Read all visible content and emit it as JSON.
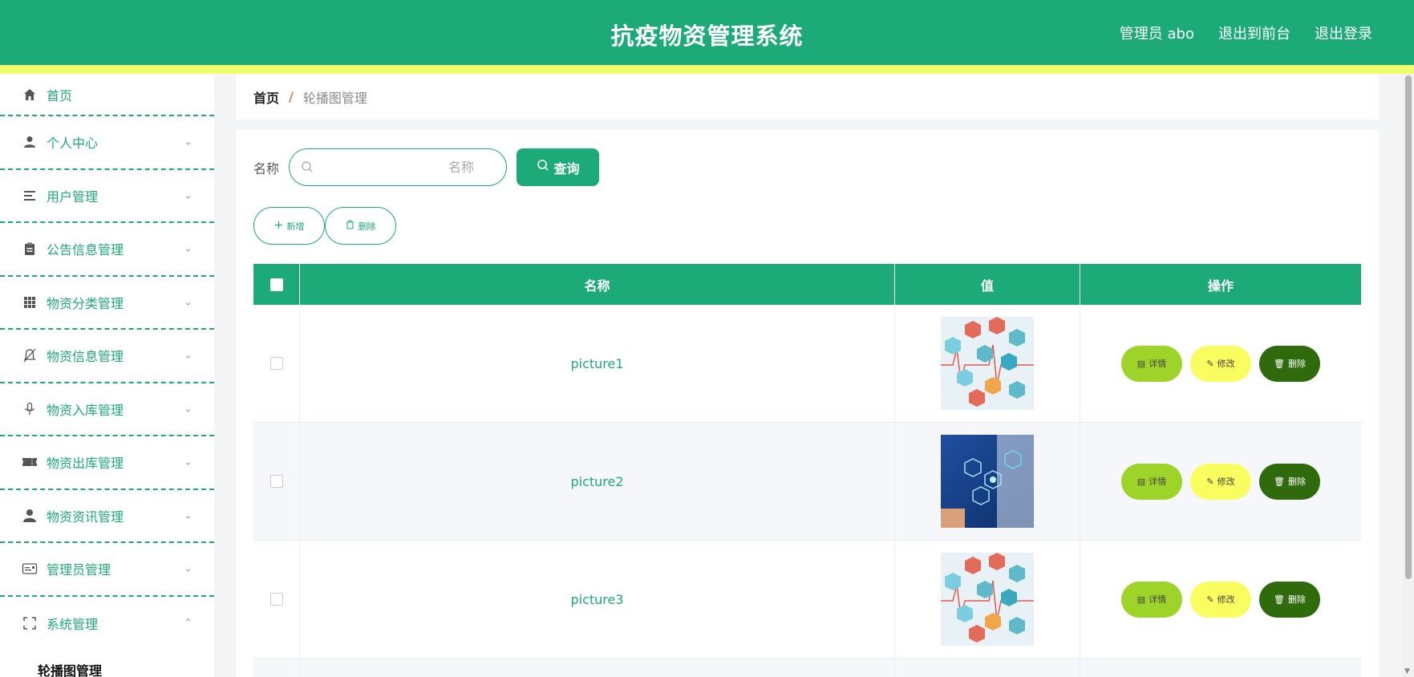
{
  "header": {
    "title": "抗疫物资管理系统",
    "links": [
      "管理员 abo",
      "退出到前台",
      "退出登录"
    ]
  },
  "colors": {
    "primary": "#1caa79",
    "accent_stripe": "#f3ff6a",
    "detail": "#9ed42a",
    "edit": "#fafd5f",
    "delete": "#2f6b0c"
  },
  "sidebar": {
    "items": [
      {
        "label": "首页",
        "icon": "home-icon",
        "expandable": false
      },
      {
        "label": "个人中心",
        "icon": "user-icon",
        "expandable": true
      },
      {
        "label": "用户管理",
        "icon": "list-icon",
        "expandable": true
      },
      {
        "label": "公告信息管理",
        "icon": "clipboard-icon",
        "expandable": true
      },
      {
        "label": "物资分类管理",
        "icon": "grid-icon",
        "expandable": true
      },
      {
        "label": "物资信息管理",
        "icon": "bell-off-icon",
        "expandable": true
      },
      {
        "label": "物资入库管理",
        "icon": "microphone-icon",
        "expandable": true
      },
      {
        "label": "物资出库管理",
        "icon": "ticket-icon",
        "expandable": true
      },
      {
        "label": "物资资讯管理",
        "icon": "person-icon",
        "expandable": true
      },
      {
        "label": "管理员管理",
        "icon": "card-icon",
        "expandable": true
      },
      {
        "label": "系统管理",
        "icon": "frame-icon",
        "expandable": true,
        "expanded": true
      }
    ],
    "sub_item": "轮播图管理"
  },
  "breadcrumb": {
    "home": "首页",
    "separator": "/",
    "current": "轮播图管理"
  },
  "search": {
    "label": "名称",
    "placeholder": "名称",
    "value": "",
    "button": "查询"
  },
  "actions": {
    "add": "新增",
    "delete": "删除"
  },
  "table": {
    "columns": [
      "名称",
      "值",
      "操作"
    ],
    "rows": [
      {
        "name": "picture1",
        "image": "medical-hexagon-pattern"
      },
      {
        "name": "picture2",
        "image": "doctor-tech-hexagon"
      },
      {
        "name": "picture3",
        "image": "medical-hexagon-pattern"
      }
    ],
    "row_ops": {
      "detail": "详情",
      "edit": "修改",
      "delete": "删除"
    }
  }
}
